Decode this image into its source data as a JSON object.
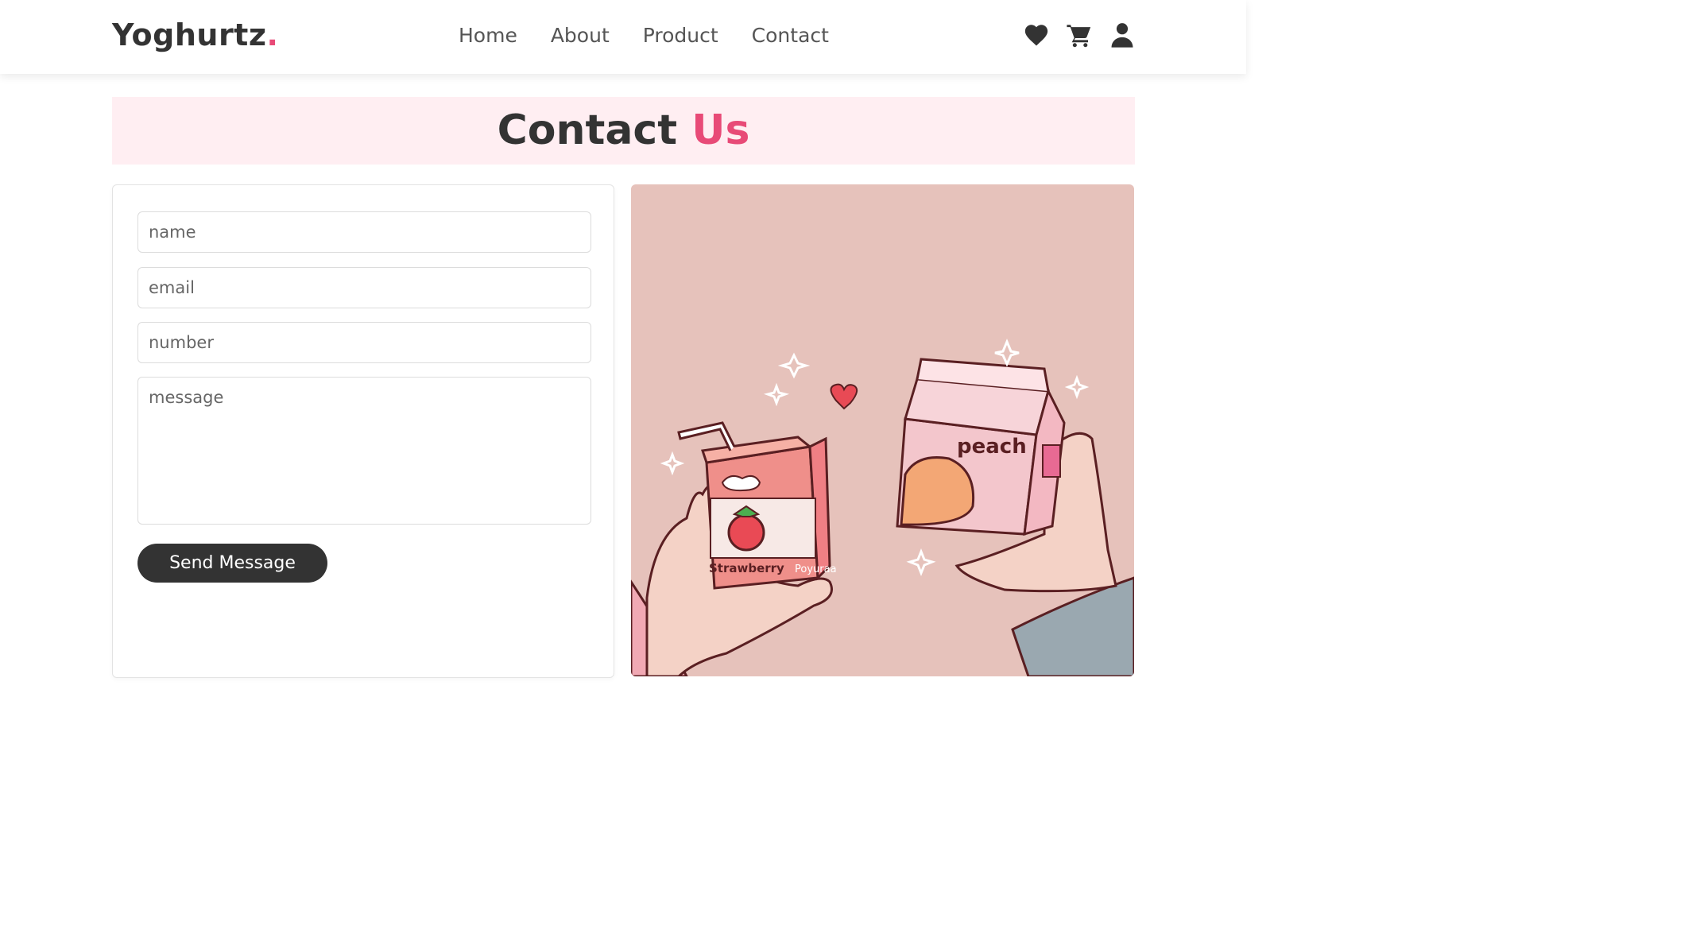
{
  "header": {
    "logo_text": "Yoghurtz",
    "logo_dot": ".",
    "nav": [
      "Home",
      "About",
      "Product",
      "Contact"
    ],
    "icons": [
      "heart-icon",
      "cart-icon",
      "user-icon"
    ]
  },
  "page_heading": {
    "text": "Contact",
    "accent": "Us"
  },
  "form": {
    "name_placeholder": "name",
    "email_placeholder": "email",
    "number_placeholder": "number",
    "message_placeholder": "message",
    "send_label": "Send Message"
  },
  "illustration": {
    "credit": "Poyuraa",
    "carton_left_label": "Strawberry",
    "carton_right_label": "peach"
  },
  "colors": {
    "accent": "#e84a77",
    "heading_bg": "#ffeef2",
    "illustration_bg": "#e6c2bb",
    "button_bg": "#333333"
  }
}
